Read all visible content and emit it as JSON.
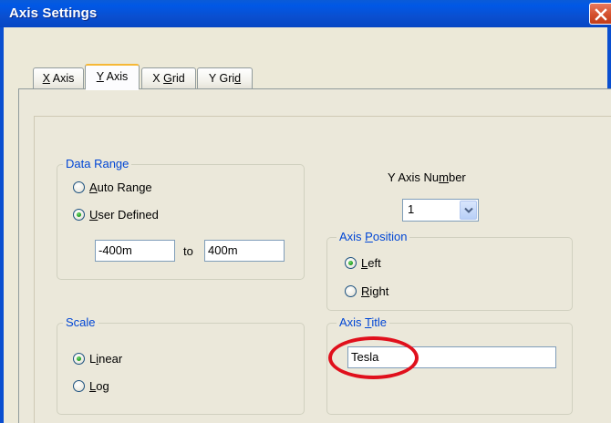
{
  "window": {
    "title": "Axis Settings"
  },
  "tabs": [
    {
      "label_pre": "",
      "label_u": "X",
      "label_post": " Axis",
      "active": false
    },
    {
      "label_pre": "",
      "label_u": "Y",
      "label_post": " Axis",
      "active": true
    },
    {
      "label_pre": "X ",
      "label_u": "G",
      "label_post": "rid",
      "active": false
    },
    {
      "label_pre": "Y Gri",
      "label_u": "d",
      "label_post": "",
      "active": false
    }
  ],
  "data_range": {
    "legend": "Data Range",
    "auto_pre": "",
    "auto_u": "A",
    "auto_post": "uto Range",
    "user_pre": "",
    "user_u": "U",
    "user_post": "ser Defined",
    "selected": "user",
    "min_value": "-400m",
    "to_label": "to",
    "max_value": "400m"
  },
  "scale": {
    "legend": "Scale",
    "linear_pre": "L",
    "linear_u": "i",
    "linear_post": "near",
    "log_pre": "",
    "log_u": "L",
    "log_post": "og",
    "selected": "linear"
  },
  "y_axis_number": {
    "label_pre": "Y Axis Nu",
    "label_u": "m",
    "label_post": "ber",
    "value": "1"
  },
  "axis_position": {
    "legend_pre": "Axis ",
    "legend_u": "P",
    "legend_post": "osition",
    "left_pre": "",
    "left_u": "L",
    "left_post": "eft",
    "right_pre": "",
    "right_u": "R",
    "right_post": "ight",
    "selected": "left"
  },
  "axis_title": {
    "legend_pre": "Axis ",
    "legend_u": "T",
    "legend_post": "itle",
    "value": "Tesla"
  },
  "colors": {
    "titlebar": "#0a4fd0",
    "legend_text": "#0046d5",
    "annotation": "#e0101c"
  }
}
